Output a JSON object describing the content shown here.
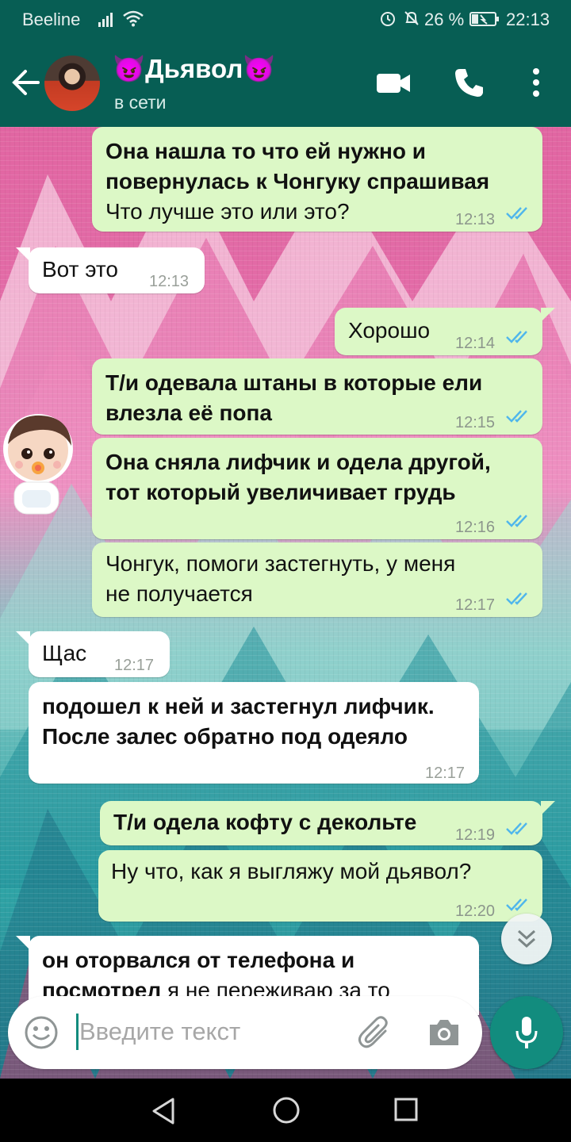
{
  "status_bar": {
    "carrier": "Beeline",
    "battery": "26 %",
    "time": "22:13"
  },
  "header": {
    "contact_name": "😈Дьявол😈",
    "presence": "в сети"
  },
  "messages": [
    {
      "dir": "out",
      "lines": [
        {
          "bold": "Она нашла то что ей нужно и"
        },
        {
          "bold": "повернулась к Чонгуку спрашивая"
        },
        {
          "text": "Что лучше это или это?"
        }
      ],
      "time": "12:13",
      "read": true
    },
    {
      "dir": "in",
      "lines": [
        {
          "text": "Вот это"
        }
      ],
      "time": "12:13"
    },
    {
      "dir": "out",
      "lines": [
        {
          "text": "Хорошо"
        }
      ],
      "time": "12:14",
      "read": true
    },
    {
      "dir": "out",
      "lines": [
        {
          "bold": "Т/и одевала штаны в которые ели"
        },
        {
          "bold": "влезла её попа"
        }
      ],
      "time": "12:15",
      "read": true
    },
    {
      "dir": "out",
      "lines": [
        {
          "bold": "Она сняла лифчик и одела другой,"
        },
        {
          "bold": "тот который увеличивает грудь"
        }
      ],
      "time": "12:16",
      "read": true
    },
    {
      "dir": "out",
      "lines": [
        {
          "text": "Чонгук, помоги застегнуть, у меня"
        },
        {
          "text": "не получается"
        }
      ],
      "time": "12:17",
      "read": true
    },
    {
      "dir": "in",
      "lines": [
        {
          "text": "Щас"
        }
      ],
      "time": "12:17"
    },
    {
      "dir": "in",
      "lines": [
        {
          "bold": "подошел к ней и застегнул лифчик."
        },
        {
          "bold": "После залес обратно под одеяло"
        }
      ],
      "time": "12:17"
    },
    {
      "dir": "out",
      "lines": [
        {
          "bold": "Т/и одела кофту с декольте"
        }
      ],
      "time": "12:19",
      "read": true
    },
    {
      "dir": "out",
      "lines": [
        {
          "text": "Ну что, как я выгляжу мой дьявол?"
        }
      ],
      "time": "12:20",
      "read": true
    },
    {
      "dir": "in",
      "lines": [
        {
          "bold": "он оторвался от телефона и"
        },
        {
          "bold": "посмотрел",
          "text": " я не переживаю за то"
        }
      ],
      "time": ""
    }
  ],
  "composer": {
    "placeholder": "Введите текст"
  },
  "colors": {
    "header": "#075e54",
    "outgoing": "#dcf8c6",
    "incoming": "#ffffff",
    "accent": "#128c7e",
    "read_ticks": "#4fb6ec"
  },
  "icons": [
    "back-arrow-icon",
    "video-call-icon",
    "phone-icon",
    "more-vert-icon",
    "emoji-icon",
    "attach-icon",
    "camera-icon",
    "mic-icon",
    "scroll-down-icon",
    "nav-back-icon",
    "nav-home-icon",
    "nav-recents-icon"
  ]
}
